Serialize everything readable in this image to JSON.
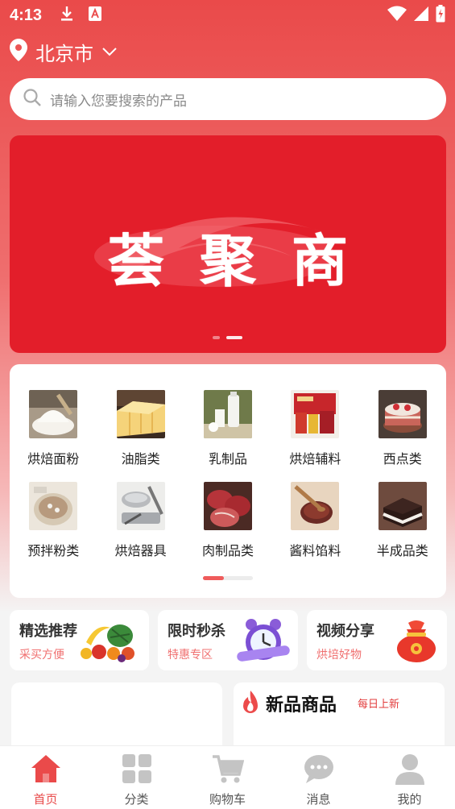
{
  "status_bar": {
    "time": "4:13"
  },
  "location": {
    "city": "北京市"
  },
  "search": {
    "placeholder": "请输入您要搜索的产品"
  },
  "banner": {
    "title": "荟聚商"
  },
  "categories": [
    {
      "label": "烘焙面粉"
    },
    {
      "label": "油脂类"
    },
    {
      "label": "乳制品"
    },
    {
      "label": "烘焙辅料"
    },
    {
      "label": "西点类"
    },
    {
      "label": "预拌粉类"
    },
    {
      "label": "烘焙器具"
    },
    {
      "label": "肉制品类"
    },
    {
      "label": "酱料馅料"
    },
    {
      "label": "半成品类"
    }
  ],
  "promos": [
    {
      "title": "精选推荐",
      "subtitle": "采买方便"
    },
    {
      "title": "限时秒杀",
      "subtitle": "特惠专区"
    },
    {
      "title": "视频分享",
      "subtitle": "烘培好物"
    }
  ],
  "new_products": {
    "title": "新品商品",
    "subtitle": "每日上新"
  },
  "tabs": [
    {
      "label": "首页"
    },
    {
      "label": "分类"
    },
    {
      "label": "购物车"
    },
    {
      "label": "消息"
    },
    {
      "label": "我的"
    }
  ],
  "colors": {
    "accent": "#e84a4a",
    "banner_red": "#e31e2a"
  }
}
